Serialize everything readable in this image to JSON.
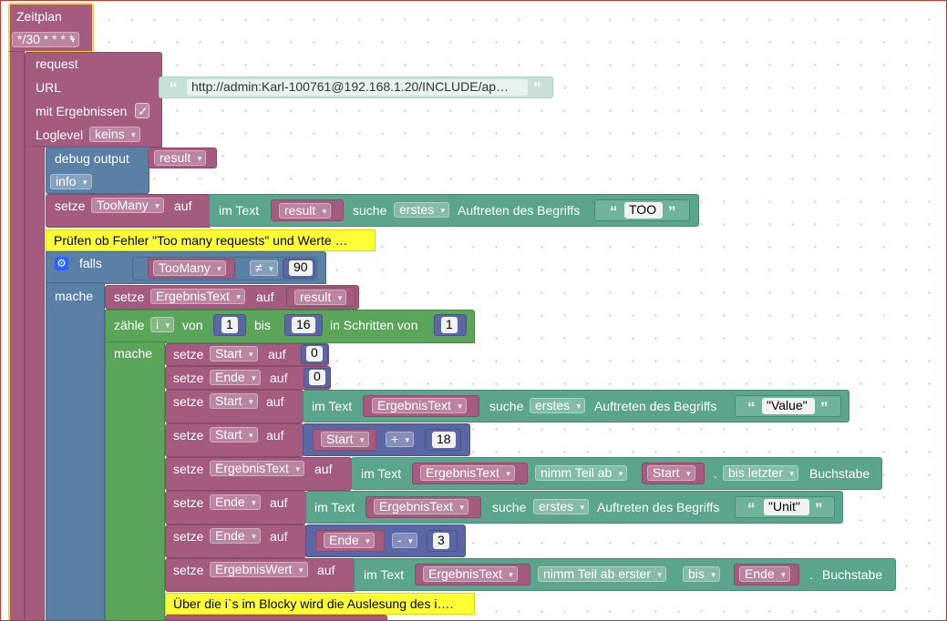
{
  "schedule": {
    "title": "Zeitplan",
    "cron": "*/30 * * * *"
  },
  "request": {
    "title": "request",
    "url_label": "URL",
    "url_value": "http://admin:Karl-100761@192.168.1.20/INCLUDE/ap…",
    "results_label": "mit Ergebnissen",
    "results_check": "✓",
    "loglevel_label": "Loglevel",
    "loglevel_value": "keins"
  },
  "debug": {
    "label": "debug output",
    "var": "result",
    "level": "info"
  },
  "set_toomany": {
    "setze": "setze",
    "var": "TooMany",
    "auf": "auf",
    "im_text": "im Text",
    "text_var": "result",
    "suche": "suche",
    "mode": "erstes",
    "rest": "Auftreten des Begriffs",
    "search": "TOO"
  },
  "comment1": "Prüfen ob  Fehler \"Too many requests\" und Werte …",
  "if_block": {
    "falls": "falls",
    "var": "TooMany",
    "op": "≠",
    "num": "90",
    "mache": "mache"
  },
  "set_erg1": {
    "setze": "setze",
    "var": "ErgebnisText",
    "auf": "auf",
    "value": "result"
  },
  "loop": {
    "zaehle": "zähle",
    "var": "i",
    "von": "von",
    "from": "1",
    "bis": "bis",
    "to": "16",
    "step_label": "in Schritten von",
    "step": "1",
    "mache": "mache"
  },
  "set_start0": {
    "setze": "setze",
    "var": "Start",
    "auf": "auf",
    "value": "0"
  },
  "set_ende0": {
    "setze": "setze",
    "var": "Ende",
    "auf": "auf",
    "value": "0"
  },
  "set_start_find": {
    "setze": "setze",
    "var": "Start",
    "auf": "auf",
    "im_text": "im Text",
    "text_var": "ErgebnisText",
    "suche": "suche",
    "mode": "erstes",
    "rest": "Auftreten des Begriffs",
    "search": "\"Value\""
  },
  "set_start_add": {
    "setze": "setze",
    "var": "Start",
    "auf": "auf",
    "a": "Start",
    "op": "+",
    "b": "18"
  },
  "set_erg_sub": {
    "setze": "setze",
    "var": "ErgebnisText",
    "auf": "auf",
    "im_text": "im Text",
    "text_var": "ErgebnisText",
    "nimm": "nimm Teil ab",
    "from_var": "Start",
    "dot": ".",
    "bis": "bis letzter",
    "buchstabe": "Buchstabe"
  },
  "set_ende_find": {
    "setze": "setze",
    "var": "Ende",
    "auf": "auf",
    "im_text": "im Text",
    "text_var": "ErgebnisText",
    "suche": "suche",
    "mode": "erstes",
    "rest": "Auftreten des Begriffs",
    "search": "\"Unit\""
  },
  "set_ende_sub": {
    "setze": "setze",
    "var": "Ende",
    "auf": "auf",
    "a": "Ende",
    "op": "-",
    "b": "3"
  },
  "set_wert": {
    "setze": "setze",
    "var": "ErgebnisWert",
    "auf": "auf",
    "im_text": "im Text",
    "text_var": "ErgebnisText",
    "nimm": "nimm Teil ab erster",
    "bis": "bis",
    "to_var": "Ende",
    "dot": ".",
    "buchstabe": "Buchstabe"
  },
  "comment2": "Über die i`s im Blocky wird die Auslesung des i….",
  "colors": {
    "procedure": "#a55b80",
    "variables": "#a55b80",
    "text": "#5ba58c",
    "math": "#5b67a5",
    "logic": "#5b80a5",
    "loops": "#5ba55b",
    "comment": "#ffff36",
    "highlight": "#fcc94a"
  }
}
